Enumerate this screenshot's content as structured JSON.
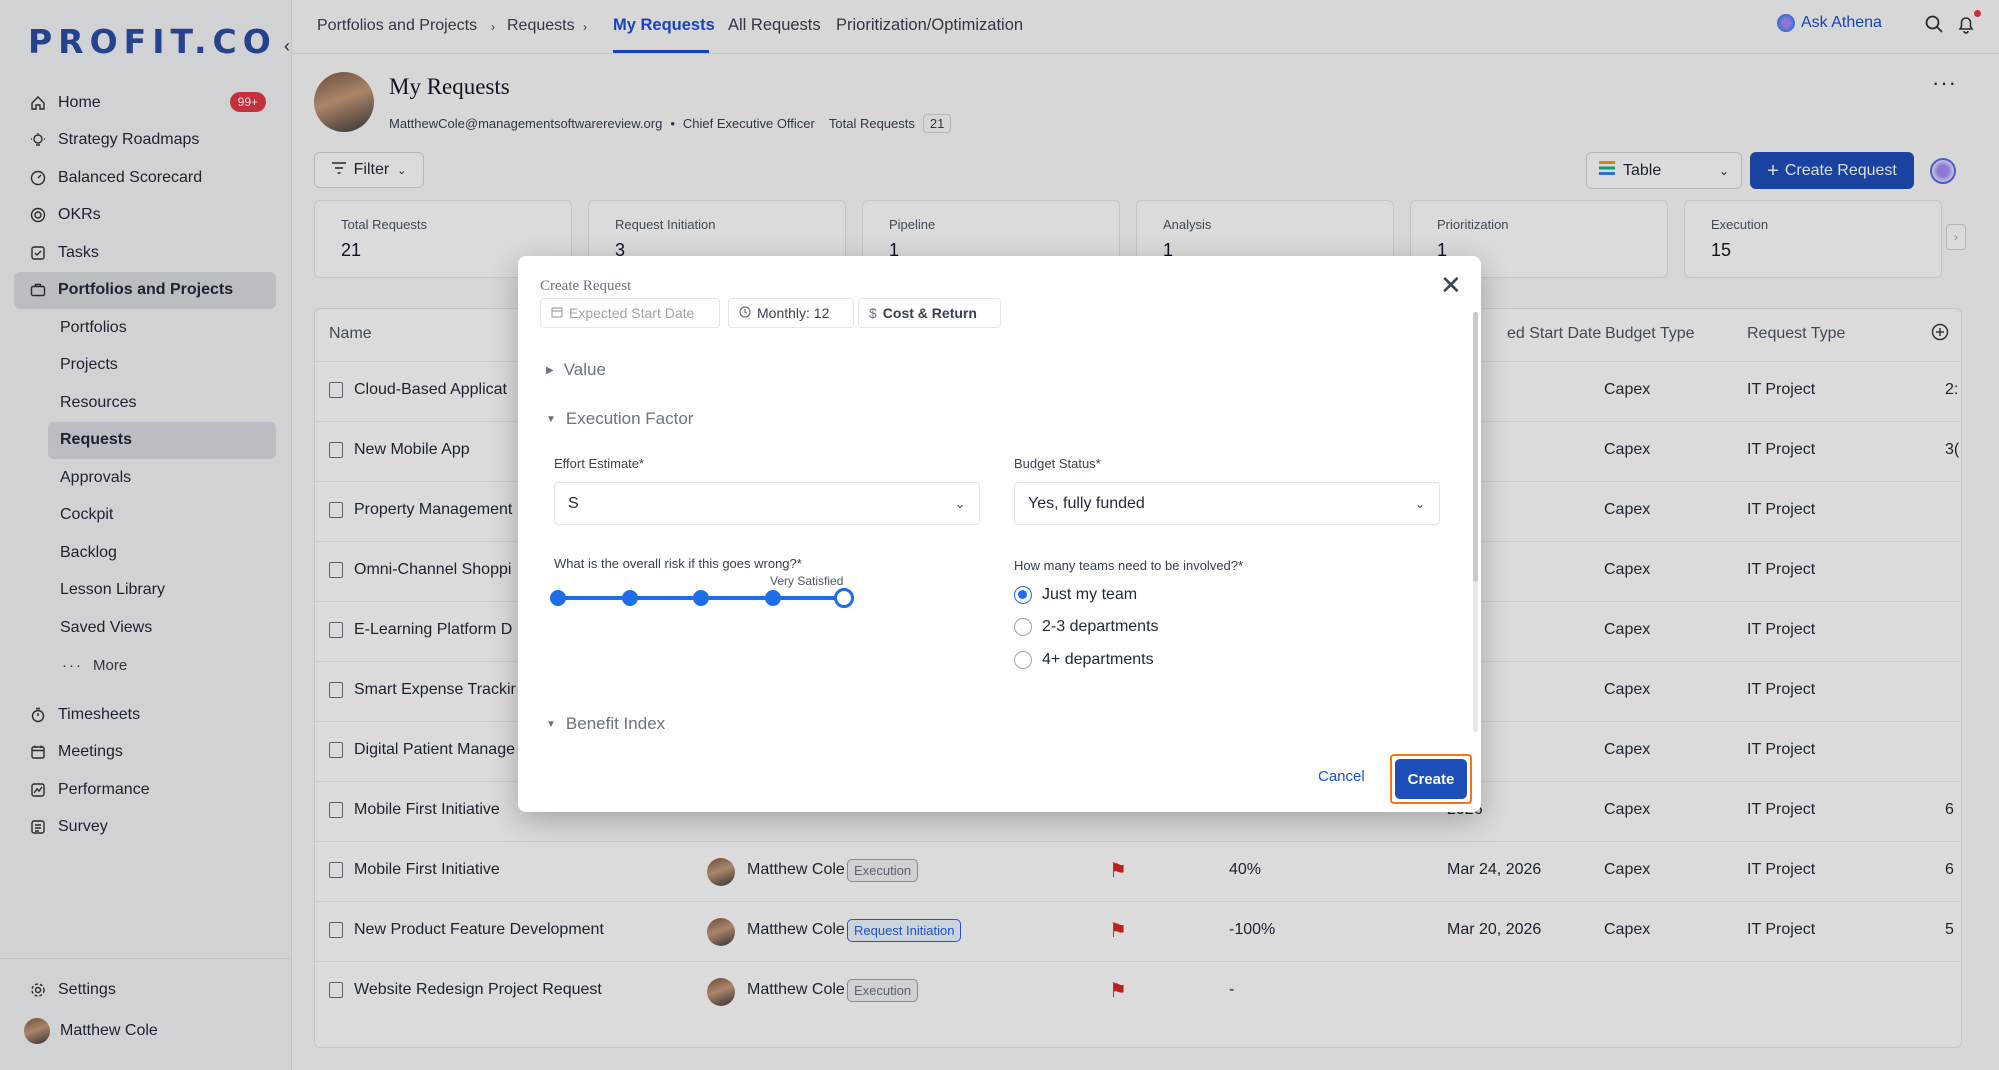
{
  "brand": {
    "logo": "PROFIT.CO"
  },
  "sidebar": {
    "items": [
      {
        "label": "Home",
        "badge": "99+"
      },
      {
        "label": "Strategy Roadmaps"
      },
      {
        "label": "Balanced Scorecard"
      },
      {
        "label": "OKRs"
      },
      {
        "label": "Tasks"
      },
      {
        "label": "Portfolios and Projects"
      }
    ],
    "subitems": [
      "Portfolios",
      "Projects",
      "Resources",
      "Requests",
      "Approvals",
      "Cockpit",
      "Backlog",
      "Lesson Library",
      "Saved Views",
      "More"
    ],
    "lower_items": [
      "Timesheets",
      "Meetings",
      "Performance",
      "Survey"
    ],
    "settings": "Settings",
    "user": "Matthew Cole"
  },
  "header": {
    "breadcrumb": [
      "Portfolios and Projects",
      "Requests"
    ],
    "tabs": [
      "My Requests",
      "All Requests",
      "Prioritization/Optimization"
    ],
    "ask": "Ask Athena"
  },
  "profile": {
    "title": "My Requests",
    "email": "MatthewCole@managementsoftwarereview.org",
    "role": "Chief Executive Officer",
    "total_label": "Total Requests",
    "total_value": "21"
  },
  "toolbar": {
    "filter": "Filter",
    "view": "Table",
    "create": "Create Request"
  },
  "cards": [
    {
      "label": "Total Requests",
      "value": "21"
    },
    {
      "label": "Request Initiation",
      "value": "3"
    },
    {
      "label": "Pipeline",
      "value": "1"
    },
    {
      "label": "Analysis",
      "value": "1"
    },
    {
      "label": "Prioritization",
      "value": "1"
    },
    {
      "label": "Execution",
      "value": "15"
    }
  ],
  "table": {
    "columns": {
      "name": "Name",
      "start": "ed Start Date",
      "budget": "Budget Type",
      "type": "Request Type"
    },
    "rows": [
      {
        "name": "Cloud-Based Applicat",
        "owner": "",
        "stage": "",
        "progress": "",
        "date": "",
        "budget": "Capex",
        "type": "IT Project",
        "extra": "2:"
      },
      {
        "name": "New Mobile App",
        "owner": "",
        "stage": "",
        "progress": "",
        "date": "",
        "budget": "Capex",
        "type": "IT Project",
        "extra": "3("
      },
      {
        "name": "Property Management",
        "owner": "",
        "stage": "",
        "progress": "",
        "date": "",
        "budget": "Capex",
        "type": "IT Project",
        "extra": ""
      },
      {
        "name": "Omni-Channel Shoppi",
        "owner": "",
        "stage": "",
        "progress": "",
        "date": "",
        "budget": "Capex",
        "type": "IT Project",
        "extra": ""
      },
      {
        "name": "E-Learning Platform D",
        "owner": "",
        "stage": "",
        "progress": "",
        "date": "",
        "budget": "Capex",
        "type": "IT Project",
        "extra": ""
      },
      {
        "name": "Smart Expense Trackir",
        "owner": "",
        "stage": "",
        "progress": "",
        "date": "",
        "budget": "Capex",
        "type": "IT Project",
        "extra": ""
      },
      {
        "name": "Digital Patient Manage",
        "owner": "",
        "stage": "",
        "progress": "",
        "date": "",
        "budget": "Capex",
        "type": "IT Project",
        "extra": ""
      },
      {
        "name": "Mobile First Initiative",
        "owner": "",
        "stage": "",
        "progress": "",
        "date": "2026",
        "budget": "Capex",
        "type": "IT Project",
        "extra": "6"
      },
      {
        "name": "Mobile First Initiative",
        "owner": "Matthew Cole",
        "stage": "Execution",
        "progress": "40%",
        "date": "Mar 24, 2026",
        "budget": "Capex",
        "type": "IT Project",
        "extra": "6"
      },
      {
        "name": "New Product Feature Development",
        "owner": "Matthew Cole",
        "stage": "Request Initiation",
        "progress": "-100%",
        "date": "Mar 20, 2026",
        "budget": "Capex",
        "type": "IT Project",
        "extra": "5"
      },
      {
        "name": "Website Redesign Project Request",
        "owner": "Matthew Cole",
        "stage": "Execution",
        "progress": "-",
        "date": "",
        "budget": "",
        "type": "",
        "extra": ""
      }
    ]
  },
  "modal": {
    "title": "Create Request",
    "chips": {
      "start": "Expected Start Date",
      "monthly": "Monthly: 12",
      "cost": "Cost & Return"
    },
    "sections": {
      "value": "Value",
      "execution": "Execution Factor",
      "benefit": "Benefit Index"
    },
    "effort": {
      "label": "Effort Estimate*",
      "value": "S"
    },
    "budget": {
      "label": "Budget Status*",
      "value": "Yes, fully funded"
    },
    "risk": {
      "label": "What is the overall risk if this goes wrong?*",
      "caption": "Very Satisfied",
      "level": 5,
      "max": 5
    },
    "teams": {
      "label": "How many teams need to be involved?*",
      "options": [
        "Just my team",
        "2-3 departments",
        "4+ departments"
      ],
      "selected": "Just my team"
    },
    "cancel": "Cancel",
    "create": "Create"
  },
  "colors": {
    "primary": "#1e4fb8",
    "accent": "#1d6ee8",
    "highlight": "#f97316",
    "flag": "#dc2626"
  }
}
